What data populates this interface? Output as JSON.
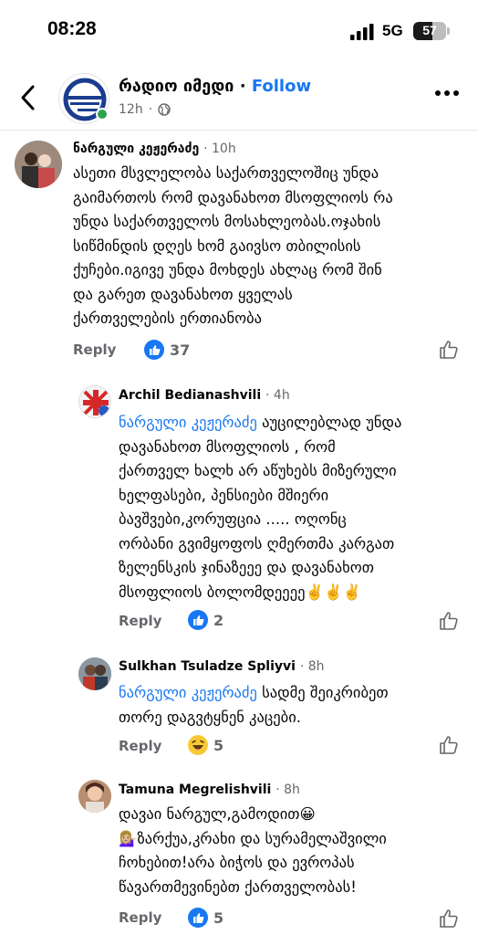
{
  "status": {
    "time": "08:28",
    "network": "5G",
    "battery": "57",
    "battery_level": 0.57
  },
  "header": {
    "page_name": "რადიო იმედი",
    "separator": "·",
    "follow_label": "Follow",
    "post_age": "12h"
  },
  "colors": {
    "link": "#1877f2",
    "muted": "#65676b",
    "online": "#31a24c"
  },
  "comments": [
    {
      "author": "ნარგული კეჟერაძე",
      "time": "· 10h",
      "text": "ასეთი მსვლელობა  საქართველოშიც უნდა\nგაიმართოს რომ დავანახოთ მსოფლიოს რა\nუნდა საქართველოს მოსახლეობას.ოჯახის\nსიწმინდის დღეს ხომ გაივსო თბილისის\nქუჩები.იგივე უნდა მოხდეს ახლაც რომ შინ\nდა გარეთ  დავანახოთ ყველას\nქართველების ერთიანობა",
      "reply_label": "Reply",
      "reaction_count": "37"
    },
    {
      "author": "Archil Bedianashvili",
      "time": "· 4h",
      "mention": "ნარგული კეჟერაძე",
      "text": " აუცილებლად უნდა\nდავანახოთ მსოფლიოს , რომ\nქართველ ხალხ არ აწუხებს მიზერული\nხელფასები, პენსიები მშიერი\nბავშვები,კორუფცია ..... ოღონც\nორბანი გვიმყოფოს ღმერთმა კარგათ\nზელენსკის ჯინაზეეე და დავანახოთ\nმსოფლიოს ბოლომდეეეე✌️✌️✌️",
      "reply_label": "Reply",
      "reaction_count": "2"
    },
    {
      "author": "Sulkhan Tsuladze Spliyvi",
      "time": "· 8h",
      "mention": "ნარგული კეჟერაძე",
      "text": " სადმე შეიკრიბეთ\nთორე დაგვტყნენ კაცები.",
      "reply_label": "Reply",
      "reaction_count": "5"
    },
    {
      "author": "Tamuna Megrelishvili",
      "time": "· 8h",
      "text": "დავაი ნარგულ,გამოდით😀\n💁🏼‍♀️ზარქუა,კრახი და სურამელაშვილი\nჩოხებით!არა ბიჭოს და ევროპას\nწავართმევინებთ ქართველობას!",
      "reply_label": "Reply",
      "reaction_count": "5"
    }
  ]
}
